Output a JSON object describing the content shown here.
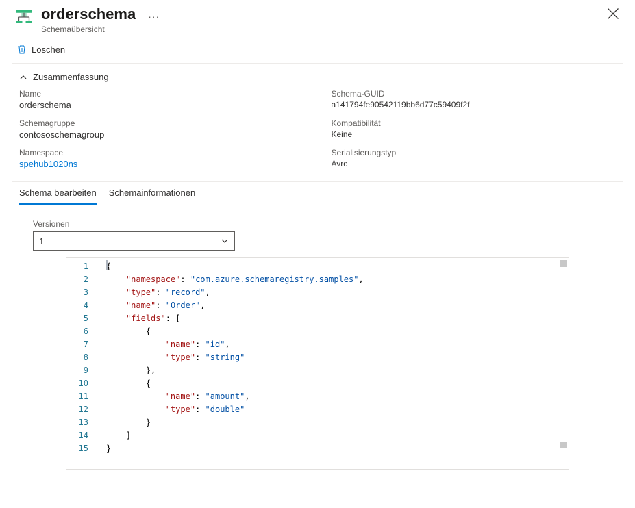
{
  "header": {
    "title": "orderschema",
    "subtitle": "Schemaübersicht",
    "more": "···"
  },
  "commands": {
    "delete": "Löschen"
  },
  "summary": {
    "toggle_label": "Zusammenfassung",
    "name_label": "Name",
    "name_value": "orderschema",
    "guid_label": "Schema-GUID",
    "guid_value": "a141794fe90542119bb6d77c59409f2f",
    "group_label": "Schemagruppe",
    "group_value": "contososchemagroup",
    "compat_label": "Kompatibilität",
    "compat_value": "Keine",
    "ns_label": "Namespace",
    "ns_value": "spehub1020ns",
    "serial_label": "Serialisierungstyp",
    "serial_value": "Avrc"
  },
  "tabs": {
    "edit": "Schema bearbeiten",
    "info": "Schemainformationen"
  },
  "versions": {
    "label": "Versionen",
    "selected": "1"
  },
  "editor": {
    "lines": [
      "1",
      "2",
      "3",
      "4",
      "5",
      "6",
      "7",
      "8",
      "9",
      "10",
      "11",
      "12",
      "13",
      "14",
      "15"
    ],
    "schema": {
      "namespace": "com.azure.schemaregistry.samples",
      "type": "record",
      "name": "Order",
      "fields": [
        {
          "name": "id",
          "type": "string"
        },
        {
          "name": "amount",
          "type": "double"
        }
      ]
    }
  }
}
